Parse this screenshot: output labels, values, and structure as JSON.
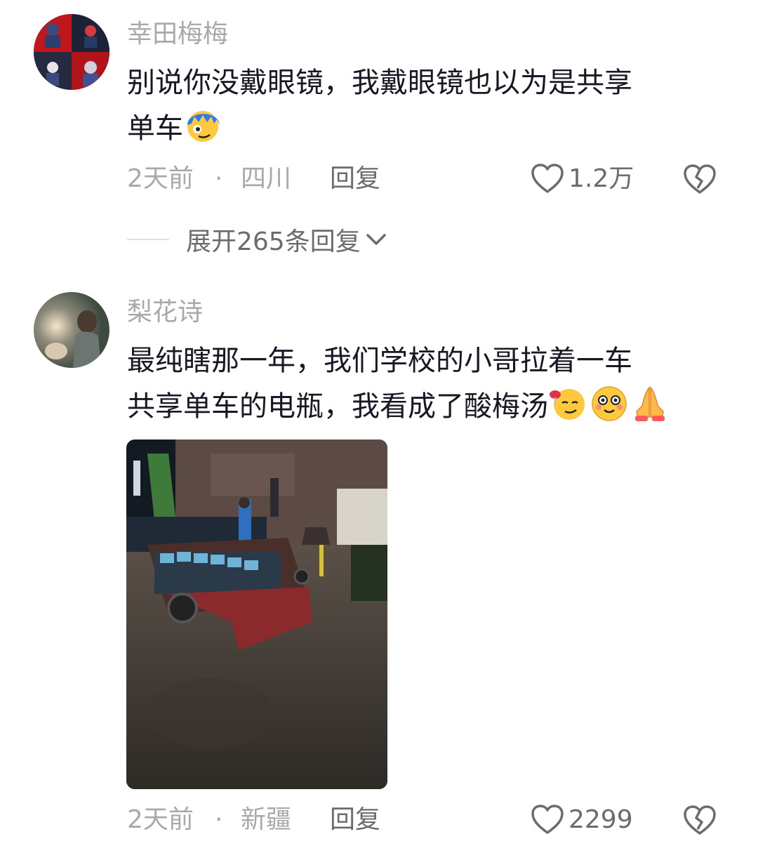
{
  "comments": [
    {
      "username": "幸田梅梅",
      "text_line1": "别说你没戴眼镜，我戴眼镜也以为是共享",
      "text_line2": "单车",
      "emojis": [
        "blue-hair-face-emoji"
      ],
      "time": "2天前",
      "separator": "·",
      "location": "四川",
      "reply_label": "回复",
      "like_count": "1.2万",
      "expand_label": "展开265条回复"
    },
    {
      "username": "梨花诗",
      "text_line1": "最纯瞎那一年，我们学校的小哥拉着一车",
      "text_line2": "共享单车的电瓶，我看成了酸梅汤",
      "emojis": [
        "wine-glass-face-emoji",
        "smiling-face-emoji",
        "praying-hands-emoji"
      ],
      "photo": "night-street-battery-cart-photo",
      "time": "2天前",
      "separator": "·",
      "location": "新疆",
      "reply_label": "回复",
      "like_count": "2299"
    }
  ],
  "colors": {
    "text": "#161823",
    "secondary": "#a9a9ab",
    "action": "#6b6b70",
    "background": "#ffffff"
  },
  "icons": [
    "heart-icon",
    "broken-heart-icon",
    "chevron-down-icon"
  ]
}
